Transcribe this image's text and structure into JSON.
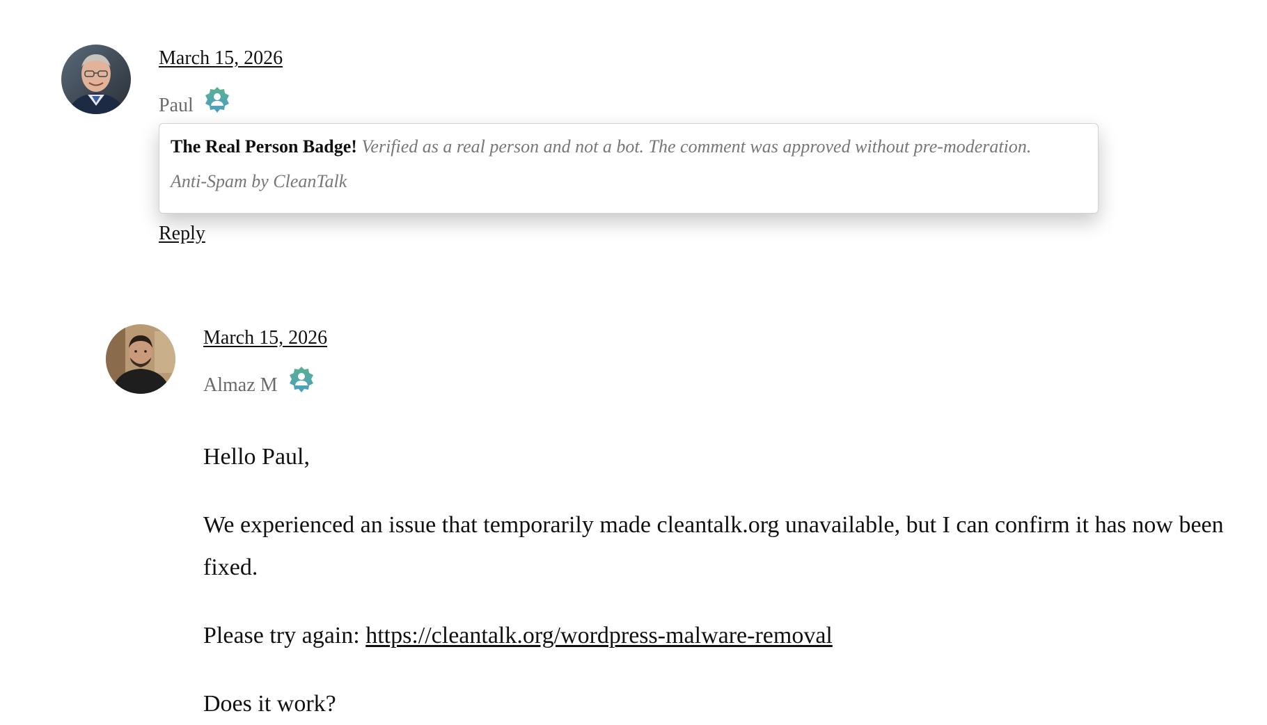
{
  "comments": [
    {
      "date": "March 15, 2026",
      "author": "Paul",
      "badge_icon": "verified-person-badge-icon",
      "tooltip": {
        "title": "The Real Person Badge!",
        "text": "Verified as a real person and not a bot. The comment was approved without pre-moderation.",
        "source": "Anti-Spam by CleanTalk"
      },
      "reply_label": "Reply"
    },
    {
      "date": "March 15, 2026",
      "author": "Almaz M",
      "badge_icon": "verified-person-badge-icon",
      "body": {
        "greeting": "Hello Paul,",
        "paragraph1": "We experienced an issue that temporarily made cleantalk.org unavailable, but I can confirm it has now been fixed.",
        "try_again_prefix": "Please try again:",
        "link": "https://cleantalk.org/wordpress-malware-removal",
        "question": "Does it work?"
      }
    }
  ],
  "colors": {
    "badge_top": "#5bb08f",
    "badge_bottom": "#4a9ec4",
    "muted_text": "#6b6b6b"
  }
}
